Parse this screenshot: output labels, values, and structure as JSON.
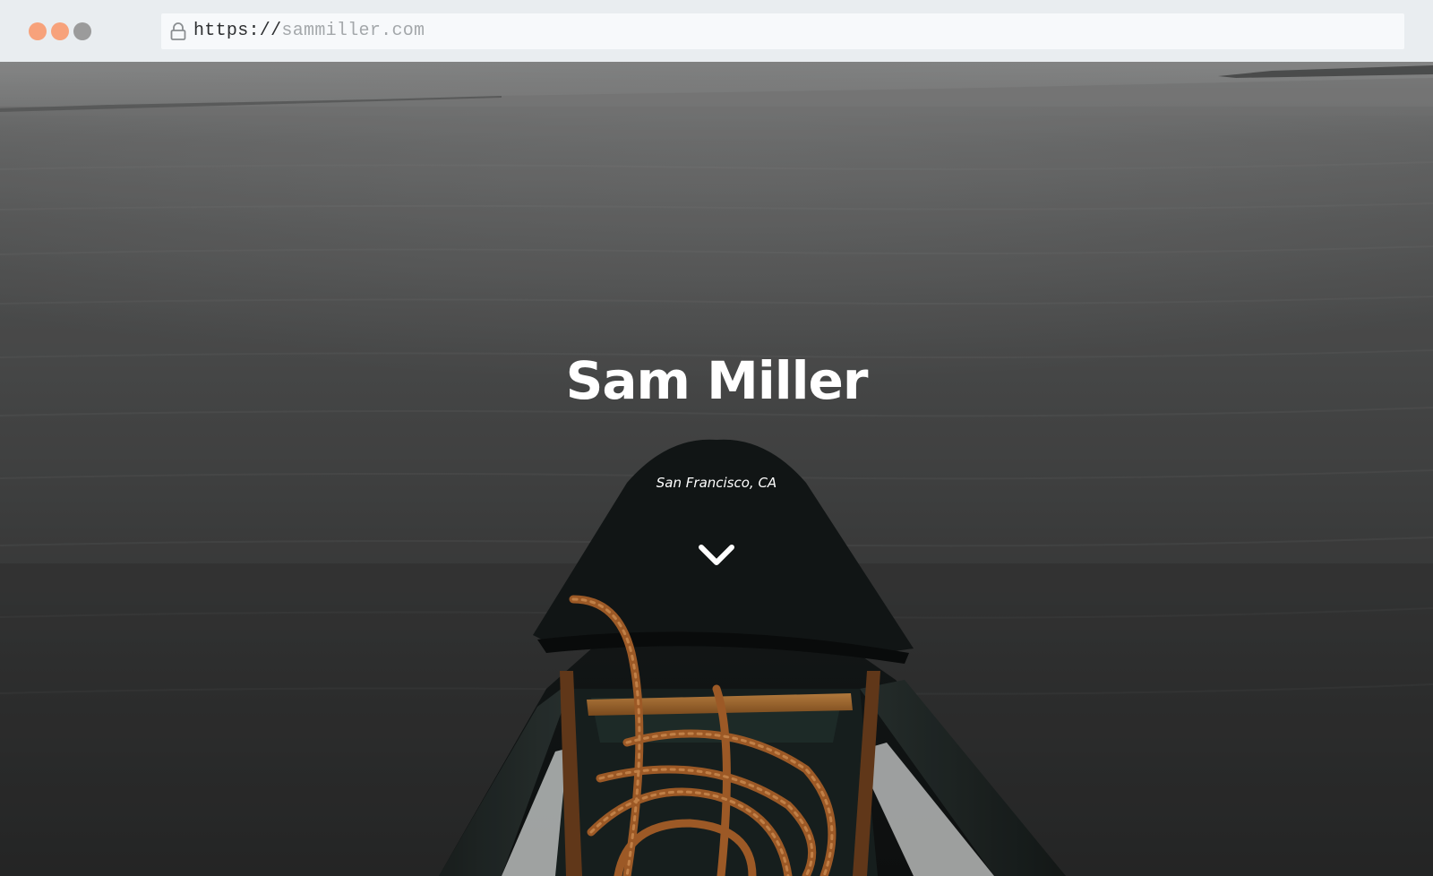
{
  "browser": {
    "window_controls": {
      "close_color": "#f7a27b",
      "minimize_color": "#f7a27b",
      "zoom_color": "#9b9b9b"
    },
    "address_bar": {
      "scheme": "https://",
      "host": "sammiller.com",
      "icon": "lock-icon"
    }
  },
  "hero": {
    "title": "Sam Miller",
    "location": "San Francisco, CA",
    "scroll_icon": "chevron-down-icon",
    "background_image": "kayak bow on calm water"
  }
}
